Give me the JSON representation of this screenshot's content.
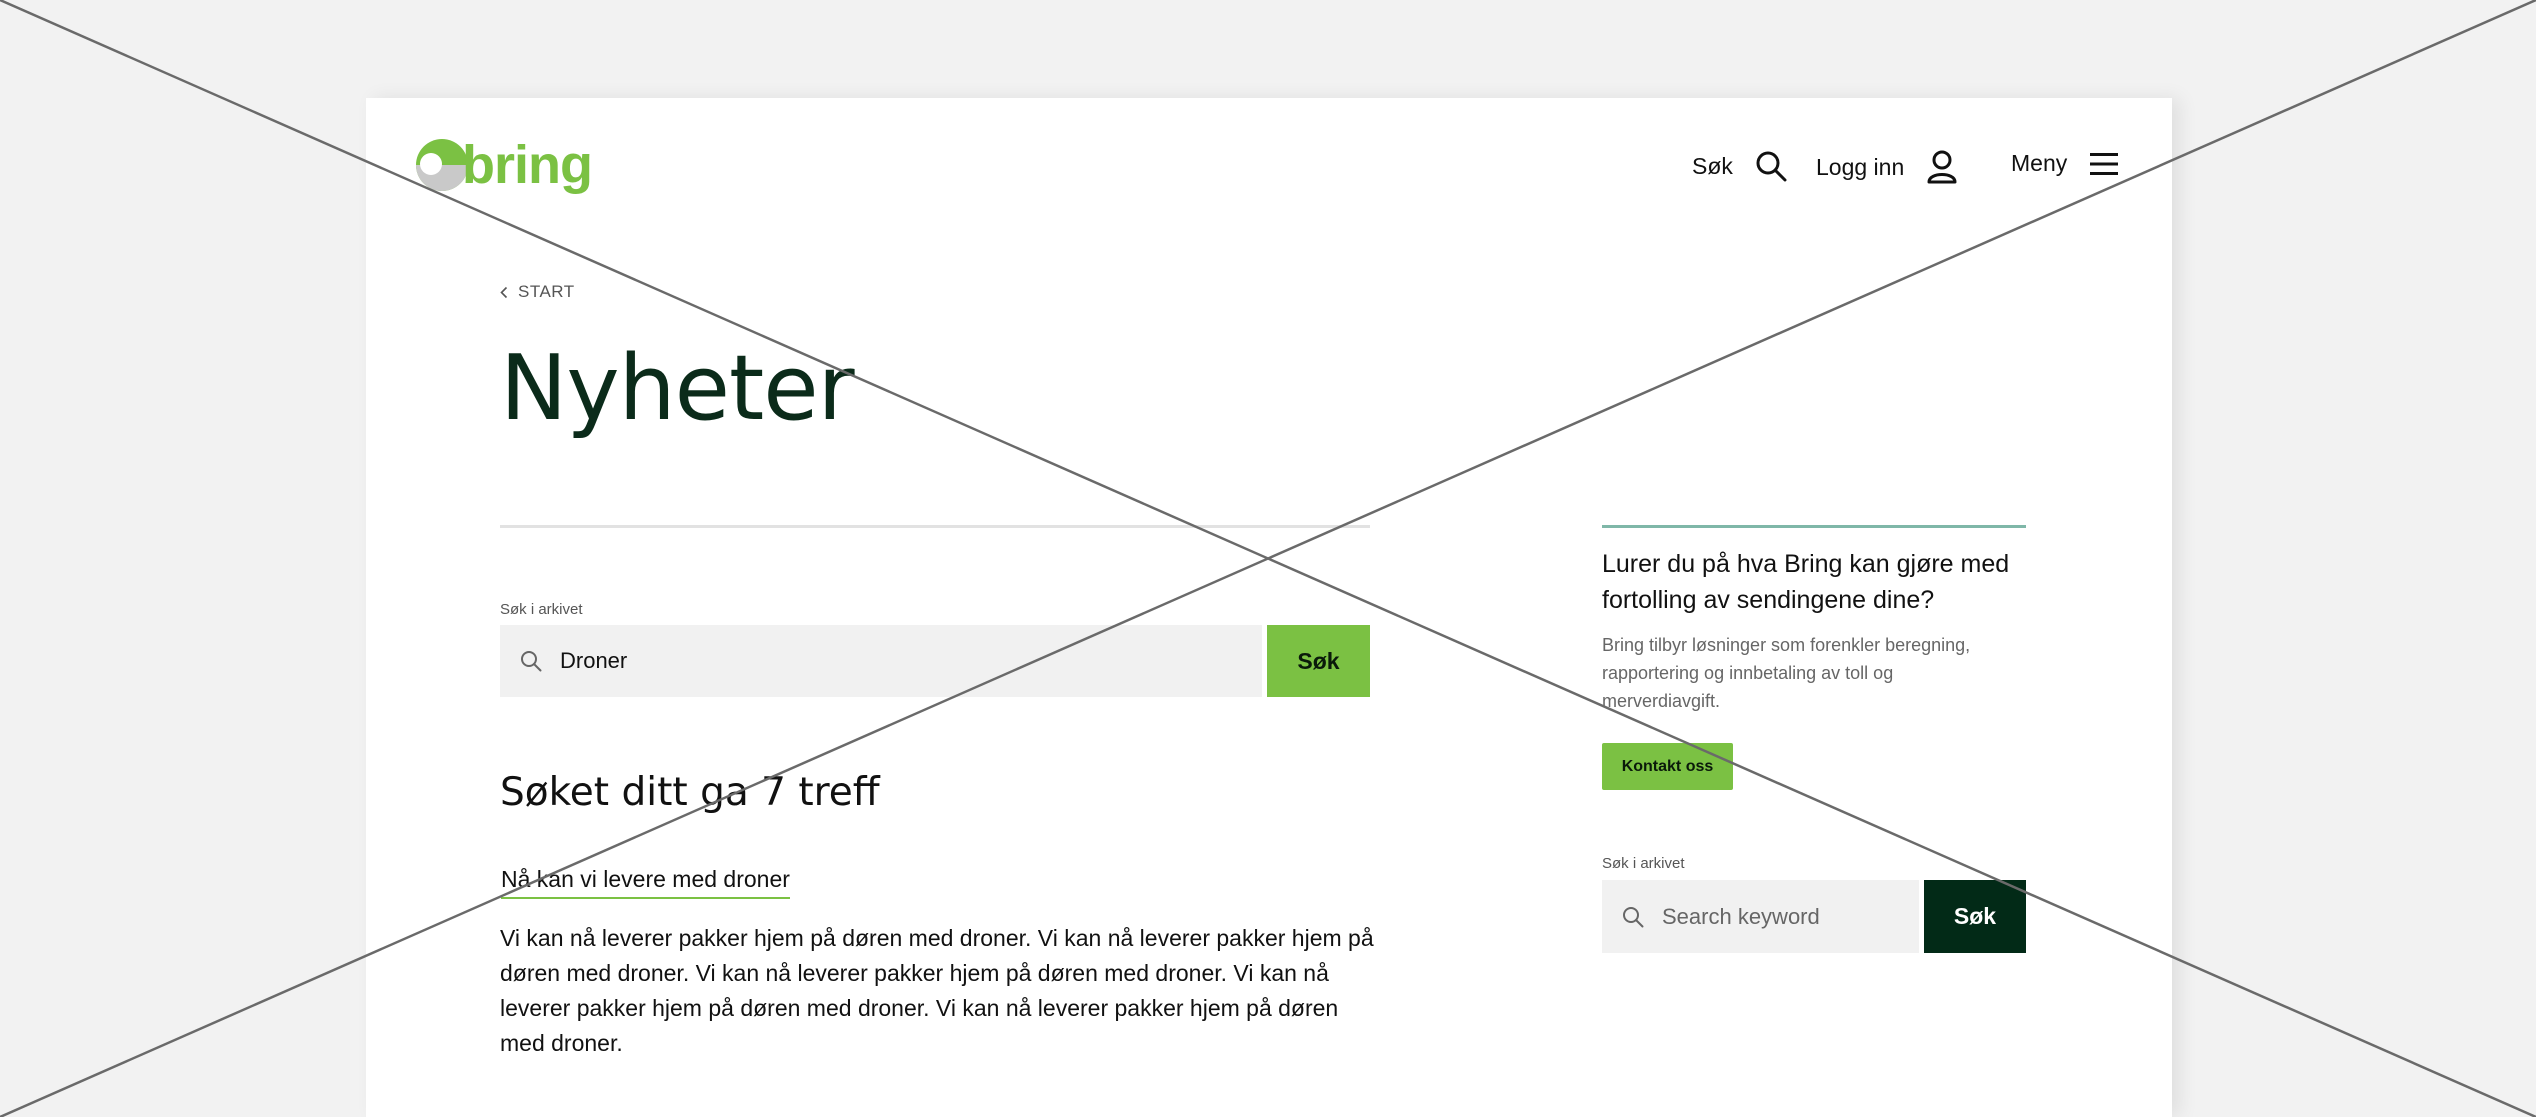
{
  "header": {
    "logo_text": "bring",
    "search_label": "Søk",
    "login_label": "Logg inn",
    "menu_label": "Meny"
  },
  "breadcrumb": {
    "label": "START"
  },
  "page_title": "Nyheter",
  "main_search": {
    "label": "Søk i arkivet",
    "value": "Droner",
    "button_label": "Søk"
  },
  "results": {
    "heading": "Søket ditt ga 7 treff",
    "items": [
      {
        "title": "Nå kan vi levere med droner",
        "body": "Vi kan nå leverer pakker hjem på døren med droner. Vi kan nå leverer pakker hjem på døren med droner. Vi kan nå leverer pakker hjem på døren med droner. Vi kan nå leverer pakker hjem på døren med droner. Vi kan nå leverer pakker hjem på døren med droner."
      }
    ]
  },
  "sidebar": {
    "heading": "Lurer du på hva Bring kan gjøre med fortolling av sendingene dine?",
    "text": "Bring tilbyr løsninger som forenkler beregning, rapportering og innbetaling av toll og merverdiavgift.",
    "contact_button": "Kontakt oss",
    "search": {
      "label": "Søk i arkivet",
      "placeholder": "Search keyword",
      "button_label": "Søk"
    }
  },
  "colors": {
    "brand_green": "#7bc143",
    "dark_green": "#022a17",
    "title_color": "#0b2b1a",
    "accent_teal": "#7fb7a8",
    "background": "#f2f2f2"
  },
  "icons": [
    "bring-logo-icon",
    "search-icon",
    "user-icon",
    "hamburger-menu-icon",
    "chevron-left-icon"
  ]
}
